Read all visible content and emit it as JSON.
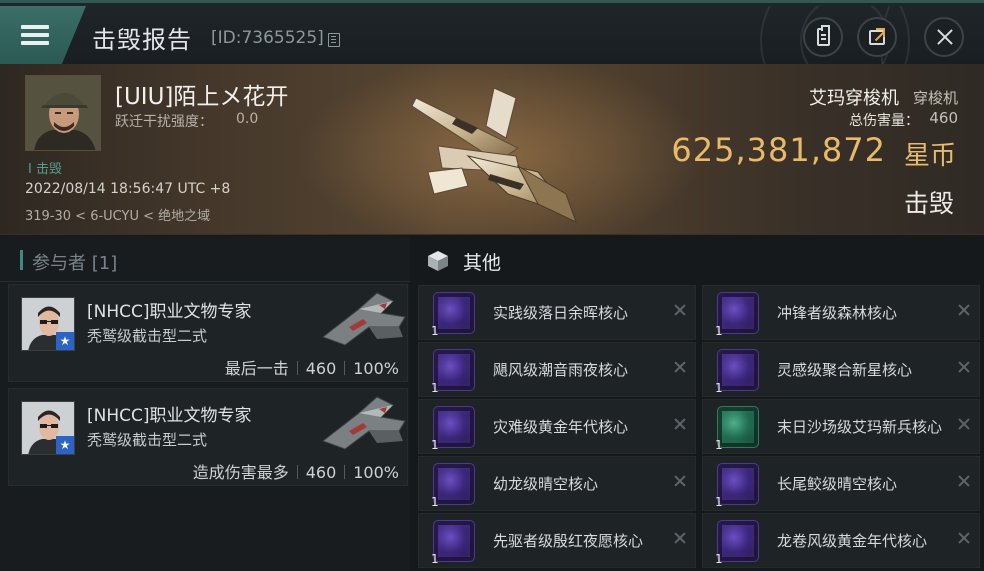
{
  "header": {
    "title": "击毁报告",
    "report_id": "[ID:7365525]",
    "icons": {
      "menu": "hamburger-icon",
      "copy": "copy-icon",
      "clipboard": "clipboard-icon",
      "share": "share-icon",
      "close": "close-icon"
    }
  },
  "victim": {
    "name": "[UIU]陌上メ花开",
    "warp_label": "跃迁干扰强度：",
    "warp_value": "0.0",
    "kill_count": "I 击毁",
    "time": "2022/08/14 18:56:47 UTC +8",
    "location": "319-30 < 6-UCYU < 绝地之域",
    "ship_name": "艾玛穿梭机",
    "ship_class": "穿梭机",
    "damage_label": "总伤害量：",
    "damage_value": "460",
    "isk_value": "625,381,872",
    "isk_unit": "星币",
    "status": "击毁"
  },
  "participants": {
    "label": "参与者 [1]",
    "list": [
      {
        "name": "[NHCC]职业文物专家",
        "ship": "秃鹫级截击型二式",
        "role": "最后一击",
        "damage": "460",
        "percent": "100%"
      },
      {
        "name": "[NHCC]职业文物专家",
        "ship": "秃鹫级截击型二式",
        "role": "造成伤害最多",
        "damage": "460",
        "percent": "100%"
      }
    ]
  },
  "items": {
    "label": "其他",
    "list": [
      {
        "name": "实践级落日余晖核心",
        "qty": "1",
        "color": "#5a3fb0"
      },
      {
        "name": "冲锋者级森林核心",
        "qty": "1",
        "color": "#5a3fb0"
      },
      {
        "name": "飓风级潮音雨夜核心",
        "qty": "1",
        "color": "#5a3fb0"
      },
      {
        "name": "灵感级聚合新星核心",
        "qty": "1",
        "color": "#5a3fb0"
      },
      {
        "name": "灾难级黄金年代核心",
        "qty": "1",
        "color": "#5a3fb0"
      },
      {
        "name": "末日沙场级艾玛新兵核心",
        "qty": "1",
        "color": "#2f8a66"
      },
      {
        "name": "幼龙级晴空核心",
        "qty": "1",
        "color": "#5a3fb0"
      },
      {
        "name": "长尾鲛级晴空核心",
        "qty": "1",
        "color": "#5a3fb0"
      },
      {
        "name": "先驱者级殷红夜愿核心",
        "qty": "1",
        "color": "#5a3fb0"
      },
      {
        "name": "龙卷风级黄金年代核心",
        "qty": "1",
        "color": "#5a3fb0"
      }
    ]
  },
  "colors": {
    "accent": "#3a6e67",
    "isk": "#e8ba6a",
    "corp_badge": "#2d63c3"
  }
}
